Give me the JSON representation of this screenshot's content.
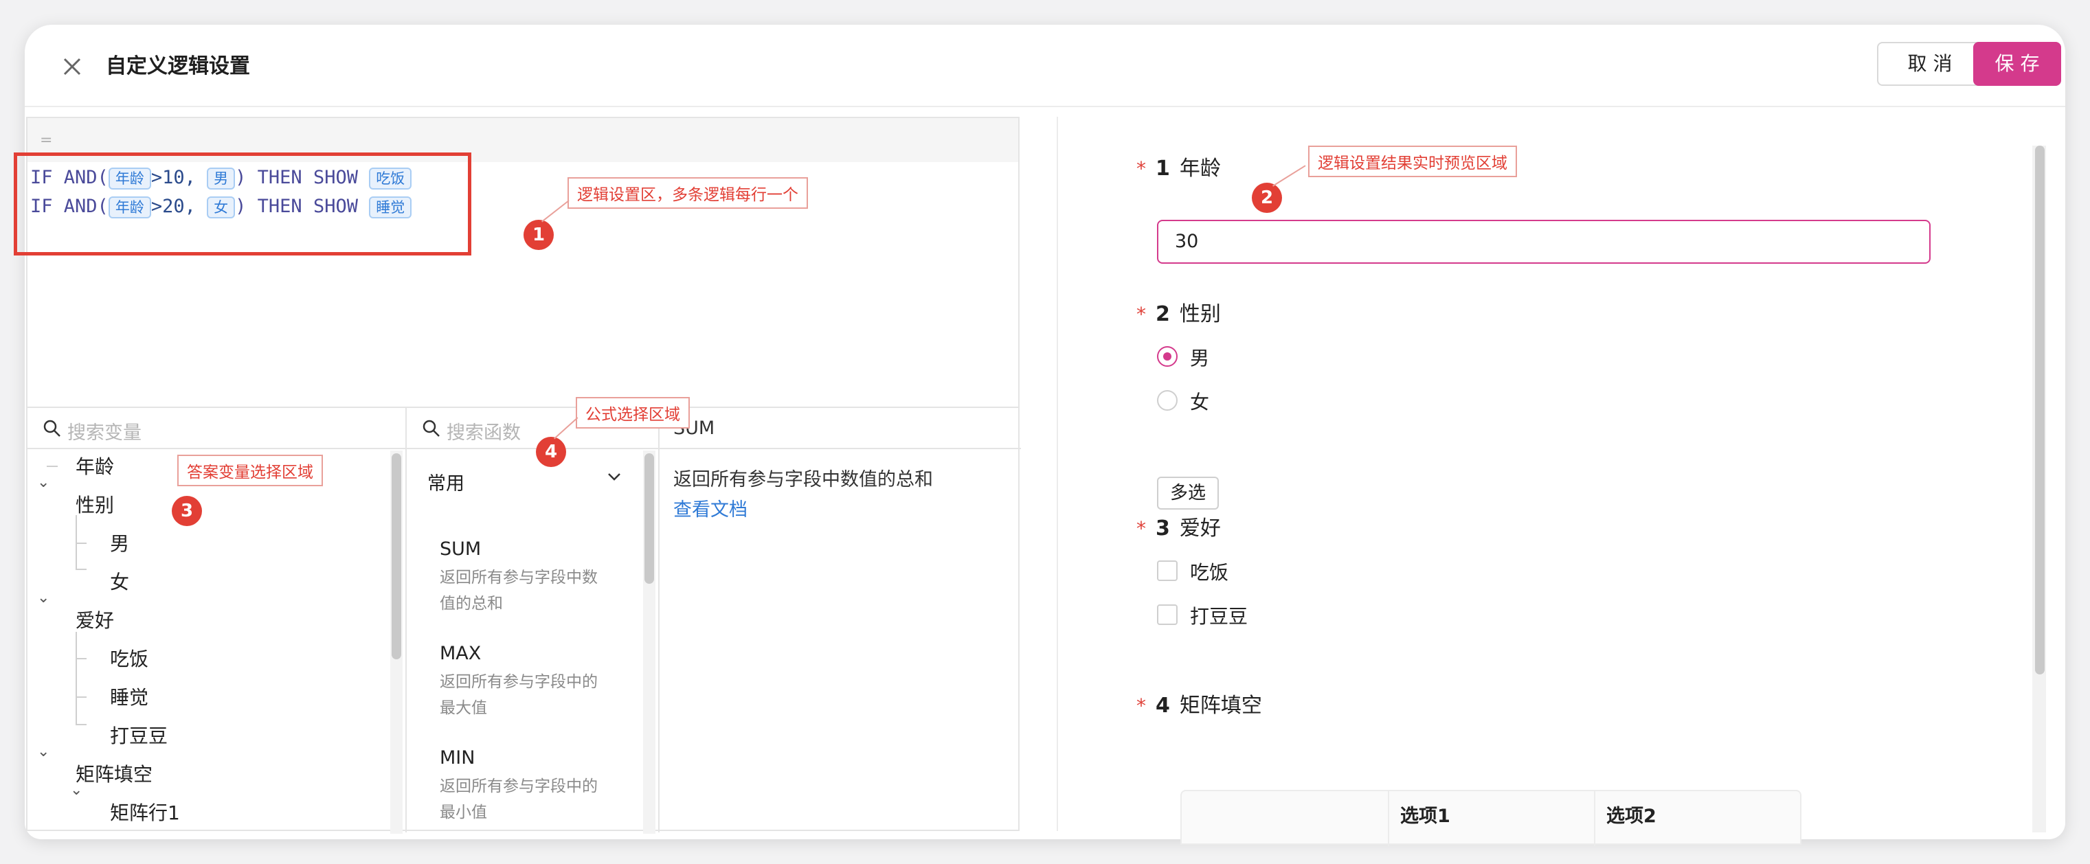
{
  "dialog": {
    "title": "自定义逻辑设置",
    "cancel_label": "取 消",
    "save_label": "保 存",
    "accent_color": "#d43a8c"
  },
  "editor": {
    "bar_symbol": "=",
    "lines": [
      {
        "kw1": "IF",
        "kw2": "AND(",
        "var": "年龄",
        "cond": ">10,",
        "value": "男",
        "close": ")",
        "kw3": "THEN",
        "kw4": "SHOW",
        "target": "吃饭"
      },
      {
        "kw1": "IF",
        "kw2": "AND(",
        "var": "年龄",
        "cond": ">20,",
        "value": "女",
        "close": ")",
        "kw3": "THEN",
        "kw4": "SHOW",
        "target": "睡觉"
      }
    ]
  },
  "variables": {
    "search_placeholder": "搜索变量",
    "tree": [
      "年龄",
      "性别",
      "男",
      "女",
      "爱好",
      "吃饭",
      "睡觉",
      "打豆豆",
      "矩阵填空",
      "矩阵行1"
    ]
  },
  "functions": {
    "search_placeholder": "搜索函数",
    "group": "常用",
    "items": [
      {
        "name": "SUM",
        "desc": "返回所有参与字段中数值的总和"
      },
      {
        "name": "MAX",
        "desc": "返回所有参与字段中的最大值"
      },
      {
        "name": "MIN",
        "desc": "返回所有参与字段中的最小值"
      }
    ]
  },
  "description": {
    "title": "SUM",
    "text": "返回所有参与字段中数值的总和",
    "link": "查看文档"
  },
  "preview": {
    "questions": [
      {
        "req": "*",
        "num": "1",
        "title": "年龄",
        "value": "30"
      },
      {
        "req": "*",
        "num": "2",
        "title": "性别",
        "options": [
          "男",
          "女"
        ],
        "selected": "男",
        "button": "多选"
      },
      {
        "req": "*",
        "num": "3",
        "title": "爱好",
        "options": [
          "吃饭",
          "打豆豆"
        ]
      },
      {
        "req": "*",
        "num": "4",
        "title": "矩阵填空",
        "columns": [
          "选项1",
          "选项2"
        ]
      }
    ]
  },
  "annotations": [
    {
      "num": "1",
      "text": "逻辑设置区，多条逻辑每行一个"
    },
    {
      "num": "2",
      "text": "逻辑设置结果实时预览区域"
    },
    {
      "num": "3",
      "text": "答案变量选择区域"
    },
    {
      "num": "4",
      "text": "公式选择区域"
    }
  ]
}
